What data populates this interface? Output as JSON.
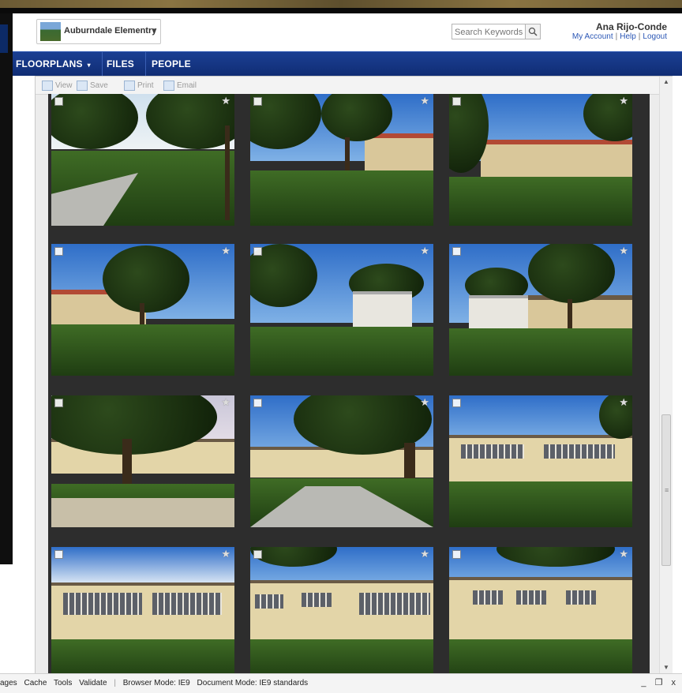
{
  "header": {
    "school_name": "Auburndale Elementry",
    "search_placeholder": "Search Keywords",
    "user_name": "Ana Rijo-Conde",
    "links": [
      "My Account",
      "Help",
      "Logout"
    ]
  },
  "nav": {
    "items": [
      {
        "label": "FLOORPLANS",
        "has_dropdown": true
      },
      {
        "label": "FILES",
        "has_dropdown": false
      },
      {
        "label": "PEOPLE",
        "has_dropdown": false
      }
    ]
  },
  "toolbar": {
    "view_label": "View",
    "save_label": "Save",
    "print_label": "Print",
    "email_label": "Email"
  },
  "statusbar": {
    "items": [
      "ages",
      "Cache",
      "Tools",
      "Validate"
    ],
    "browser_mode": "Browser Mode: IE9",
    "document_mode": "Document Mode: IE9 standards",
    "controls": [
      "_",
      "❐",
      "x"
    ]
  },
  "icons": {
    "search": "search-icon",
    "star": "star-icon",
    "checkbox": "checkbox-icon",
    "view": "view-icon",
    "save": "save-icon",
    "print": "print-icon",
    "email": "email-icon"
  },
  "colors": {
    "nav_bg": "#12317c",
    "link": "#2a56b5",
    "grid_bg": "#2d2d2d"
  },
  "photos_count": 12
}
